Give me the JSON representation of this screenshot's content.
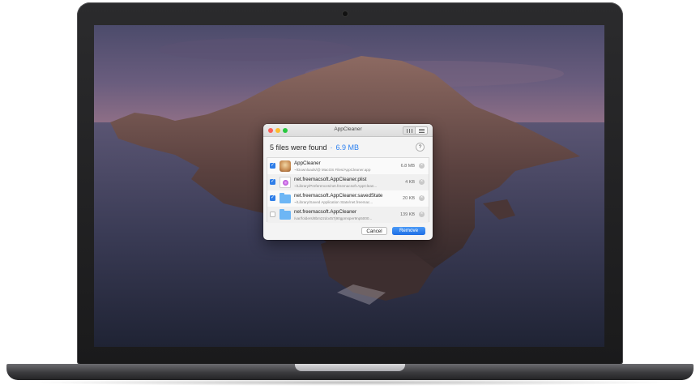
{
  "window": {
    "title": "AppCleaner"
  },
  "summary": {
    "found_text": "5 files were found",
    "separator": "·",
    "total_size": "6.9 MB"
  },
  "help_label": "?",
  "files": [
    {
      "checked": true,
      "icon": "app-icon",
      "name": "AppCleaner",
      "path": "~/Downloads/@ MacOS Files/AppCleaner.app",
      "size": "6.8 MB"
    },
    {
      "checked": true,
      "icon": "plist-file-icon",
      "name": "net.freemacsoft.AppCleaner.plist",
      "path": "~/Library/Preferences/net.freemacsoft.AppClean...",
      "size": "4 KB"
    },
    {
      "checked": true,
      "icon": "folder-icon",
      "name": "net.freemacsoft.AppCleaner.savedState",
      "path": "~/Library/Saved Application State/net.freemac...",
      "size": "20 KB"
    },
    {
      "checked": false,
      "icon": "folder-icon",
      "name": "net.freemacsoft.AppCleaner",
      "path": "/var/folders/8bm2zdo457j90gpmsper9np5000...",
      "size": "139 KB"
    }
  ],
  "glyphs": {
    "check": "✓",
    "remove": "×"
  },
  "buttons": {
    "cancel": "Cancel",
    "remove": "Remove"
  },
  "colors": {
    "accent": "#2f7ee8",
    "size_text": "#2a7ff0"
  }
}
